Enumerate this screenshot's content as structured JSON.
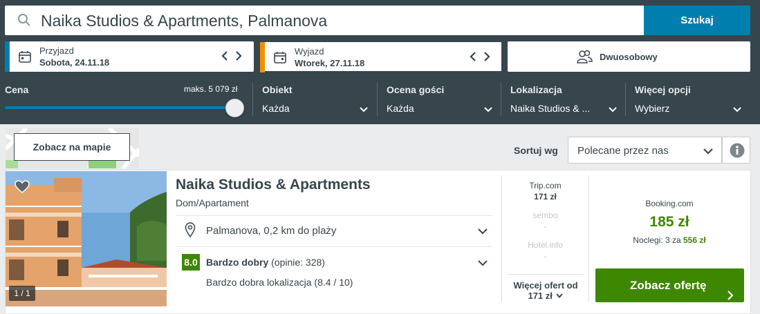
{
  "search": {
    "value": "Naika Studios & Apartments, Palmanova",
    "button": "Szukaj"
  },
  "checkin": {
    "label": "Przyjazd",
    "value": "Sobota, 24.11.18"
  },
  "checkout": {
    "label": "Wyjazd",
    "value": "Wtorek, 27.11.18"
  },
  "room": {
    "value": "Dwuosobowy"
  },
  "filters": {
    "price": {
      "label": "Cena",
      "max": "maks. 5 079 zł",
      "level": 1.0
    },
    "property": {
      "label": "Obiekt",
      "value": "Każda"
    },
    "guest_rating": {
      "label": "Ocena gości",
      "value": "Każda"
    },
    "location": {
      "label": "Lokalizacja",
      "value": "Naika Studios & ..."
    },
    "more": {
      "label": "Więcej opcji",
      "value": "Wybierz"
    }
  },
  "map_button": "Zobacz na mapie",
  "sort": {
    "label": "Sortuj wg",
    "value": "Polecane przez nas"
  },
  "hotel": {
    "name": "Naika Studios & Apartments",
    "type": "Dom/Apartament",
    "location": "Palmanova, 0,2 km do plaży",
    "score": "8.0",
    "rating_label": "Bardzo dobry",
    "rating_reviews": "(opinie: 328)",
    "rating_detail": "Bardzo dobra lokalizacja (8.4 / 10)",
    "photo_counter": "1 / 1"
  },
  "alt_offers": [
    {
      "site": "Trip.com",
      "price": "171 zł"
    },
    {
      "site": "sembo",
      "price": "-"
    },
    {
      "site": "Hotel.info",
      "price": "-"
    }
  ],
  "more_offers": {
    "label": "Więcej ofert od",
    "price": "171 zł"
  },
  "best_offer": {
    "site": "Booking.com",
    "price": "185 zł",
    "nights_prefix": "Noclegi: 3 za",
    "nights_total": "556 zł",
    "button": "Zobacz ofertę"
  },
  "colors": {
    "header": "#37454d",
    "blue": "#007faf",
    "orange": "#f48f00",
    "green": "#3e8700"
  }
}
